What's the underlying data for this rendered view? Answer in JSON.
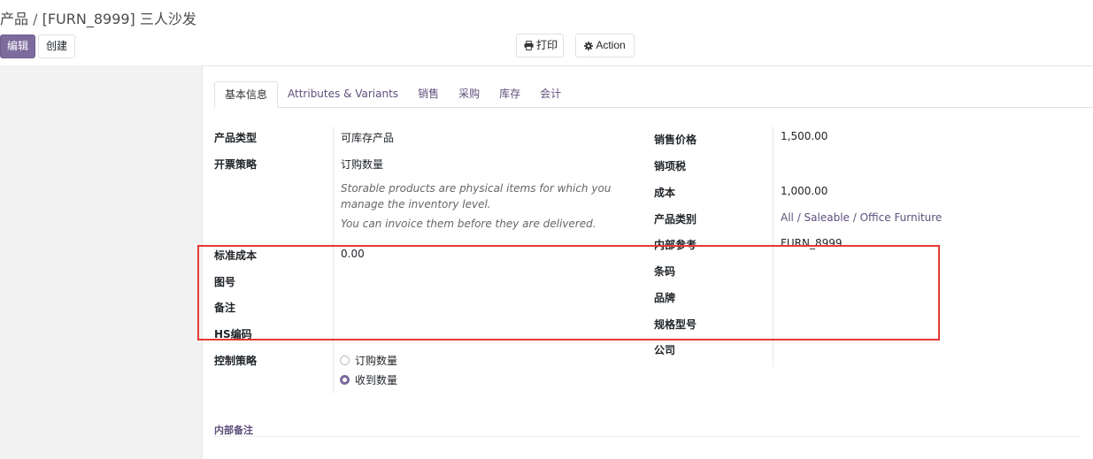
{
  "breadcrumb": {
    "parent": "产品",
    "separator": "/",
    "current": "[FURN_8999] 三人沙发"
  },
  "toolbar": {
    "edit": "编辑",
    "create": "创建",
    "print": "打印",
    "action": "Action"
  },
  "tabs": [
    "基本信息",
    "Attributes & Variants",
    "销售",
    "采购",
    "库存",
    "会计"
  ],
  "left_fields": {
    "product_type": {
      "label": "产品类型",
      "value": "可库存产品"
    },
    "invoice_policy": {
      "label": "开票策略",
      "value": "订购数量"
    },
    "help_1": "Storable products are physical items for which you manage the inventory level.",
    "help_2": "You can invoice them before they are delivered.",
    "standard_cost": {
      "label": "标准成本",
      "value": "0.00"
    },
    "drawing_no": {
      "label": "图号",
      "value": ""
    },
    "remark": {
      "label": "备注",
      "value": ""
    },
    "hs_code": {
      "label": "HS编码",
      "value": ""
    },
    "control_policy": {
      "label": "控制策略",
      "options": [
        "订购数量",
        "收到数量"
      ],
      "selected": "收到数量"
    }
  },
  "right_fields": {
    "sales_price": {
      "label": "销售价格",
      "value": "1,500.00"
    },
    "sales_tax": {
      "label": "销项税",
      "value": ""
    },
    "cost": {
      "label": "成本",
      "value": "1,000.00"
    },
    "category": {
      "label": "产品类别",
      "value": "All / Saleable / Office Furniture"
    },
    "internal_ref": {
      "label": "内部参考",
      "value": "FURN_8999"
    },
    "barcode": {
      "label": "条码",
      "value": ""
    },
    "brand": {
      "label": "品牌",
      "value": ""
    },
    "model": {
      "label": "规格型号",
      "value": ""
    },
    "company": {
      "label": "公司",
      "value": ""
    }
  },
  "internal_notes": "内部备注",
  "colors": {
    "primary": "#7c6b9c",
    "link": "#5e4f7c",
    "highlight": "#e53935"
  }
}
